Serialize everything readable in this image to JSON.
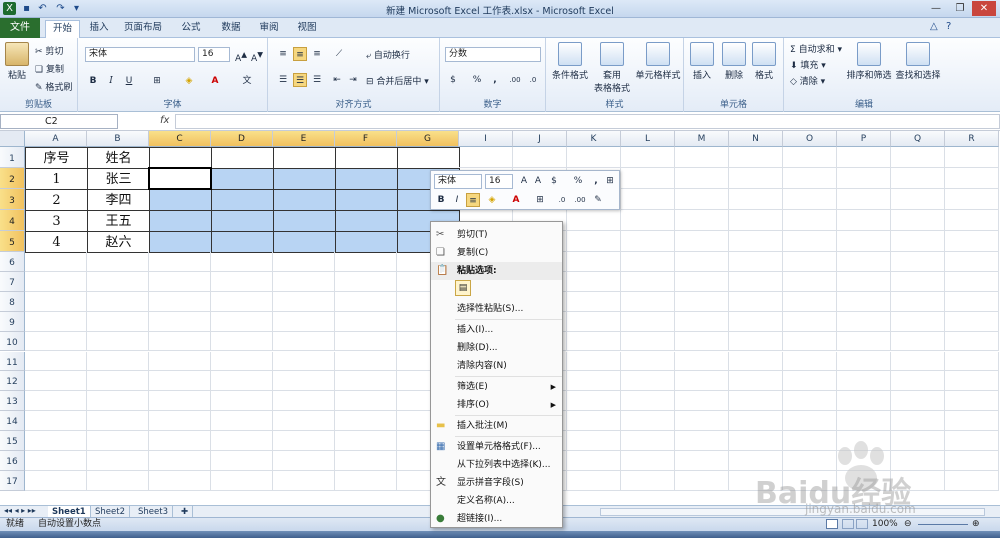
{
  "window": {
    "title": "新建 Microsoft Excel 工作表.xlsx - Microsoft Excel"
  },
  "ribbon_tabs": [
    "文件",
    "开始",
    "插入",
    "页面布局",
    "公式",
    "数据",
    "审阅",
    "视图"
  ],
  "clipboard": {
    "paste": "粘贴",
    "cut": "剪切",
    "copy": "复制",
    "format_painter": "格式刷",
    "label": "剪贴板"
  },
  "font": {
    "name": "宋体",
    "size": "16",
    "bold": "B",
    "italic": "I",
    "underline": "U",
    "label": "字体"
  },
  "alignment": {
    "wrap": "自动换行",
    "merge": "合并后居中",
    "label": "对齐方式"
  },
  "number": {
    "format": "分数",
    "percent": "%",
    "comma": ",",
    "label": "数字"
  },
  "styles": {
    "conditional": "条件格式",
    "table_line1": "套用",
    "table_line2": "表格格式",
    "cell_styles": "单元格样式",
    "label": "样式"
  },
  "cells": {
    "insert": "插入",
    "delete": "删除",
    "format": "格式",
    "label": "单元格"
  },
  "editing": {
    "autosum": "自动求和",
    "fill": "填充",
    "clear": "清除",
    "sort": "排序和筛选",
    "find": "查找和选择",
    "label": "编辑"
  },
  "formula_bar": {
    "name_box": "C2",
    "fx": "fx",
    "value": ""
  },
  "columns": [
    "A",
    "B",
    "C",
    "D",
    "E",
    "F",
    "G",
    "I",
    "J",
    "K",
    "L",
    "M",
    "N",
    "O",
    "P",
    "Q",
    "R"
  ],
  "rows": [
    "1",
    "2",
    "3",
    "4",
    "5",
    "6",
    "7",
    "8",
    "9",
    "10",
    "11",
    "12",
    "13",
    "14",
    "15",
    "16",
    "17"
  ],
  "table": {
    "header": [
      "序号",
      "姓名"
    ],
    "data": [
      [
        "1",
        "张三"
      ],
      [
        "2",
        "李四"
      ],
      [
        "3",
        "王五"
      ],
      [
        "4",
        "赵六"
      ]
    ]
  },
  "mini_toolbar": {
    "font": "宋体",
    "size": "16",
    "bold": "B",
    "italic": "I",
    "percent": "%",
    "comma": ","
  },
  "context_menu": [
    {
      "label": "剪切(T)",
      "icon": "scissors-icon"
    },
    {
      "label": "复制(C)",
      "icon": "copy-icon"
    },
    {
      "label": "粘贴选项:",
      "icon": "paste-icon"
    },
    {
      "label": "",
      "icon": "paste-option-icon"
    },
    {
      "label": "选择性粘贴(S)...",
      "icon": ""
    },
    {
      "label": "插入(I)...",
      "icon": ""
    },
    {
      "label": "删除(D)...",
      "icon": ""
    },
    {
      "label": "清除内容(N)",
      "icon": ""
    },
    {
      "label": "筛选(E)",
      "icon": "",
      "submenu": true
    },
    {
      "label": "排序(O)",
      "icon": "",
      "submenu": true
    },
    {
      "label": "插入批注(M)",
      "icon": "comment-icon"
    },
    {
      "label": "设置单元格格式(F)...",
      "icon": "format-cells-icon"
    },
    {
      "label": "从下拉列表中选择(K)...",
      "icon": ""
    },
    {
      "label": "显示拼音字段(S)",
      "icon": "phonetic-icon"
    },
    {
      "label": "定义名称(A)...",
      "icon": ""
    },
    {
      "label": "超链接(I)...",
      "icon": "hyperlink-icon"
    }
  ],
  "sheets": [
    "Sheet1",
    "Sheet2",
    "Sheet3"
  ],
  "status": {
    "ready": "就绪",
    "auto_decimal": "自动设置小数点",
    "zoom": "100%"
  },
  "watermark": {
    "brand": "Baidu经验",
    "url": "jingyan.baidu.com"
  }
}
